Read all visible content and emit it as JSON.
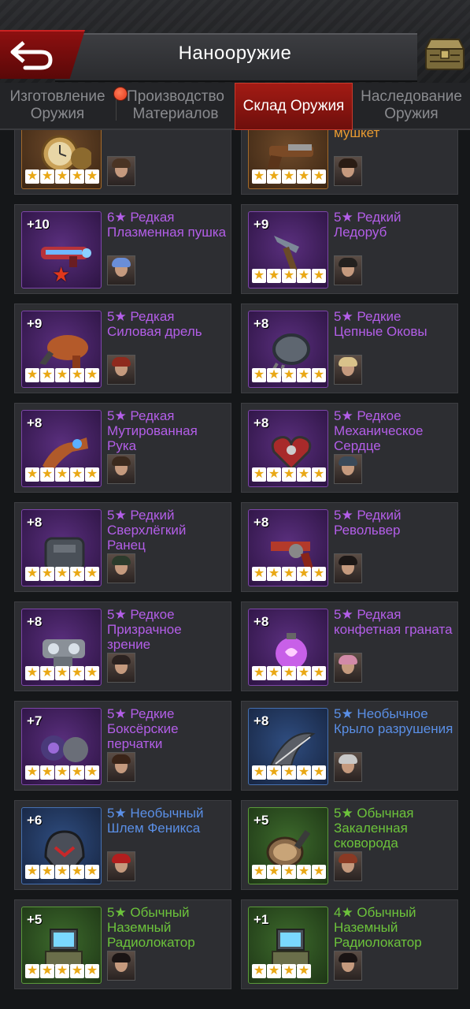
{
  "header": {
    "title": "Нанооружие",
    "back_icon": "back-arrow-icon",
    "chest_icon": "weapon-chest-icon"
  },
  "tabs": [
    {
      "label": "Изготовление Оружия",
      "has_notification": true
    },
    {
      "label": "Производство Материалов",
      "has_notification": false
    },
    {
      "label": "Склад Оружия",
      "active": true
    },
    {
      "label": "Наследование Оружия",
      "has_notification": false
    }
  ],
  "colors": {
    "rare": "#b35ee8",
    "legendary": "#e79a31",
    "uncommon": "#5a8fe6",
    "common": "#6cc33b",
    "active_tab": "#a31b14"
  },
  "weapons": [
    {
      "name": "Карманные часы",
      "level": "",
      "stars": 5,
      "rarity": "orange",
      "avatar_hair": "#4a3424",
      "icon": "pocket-watch-icon"
    },
    {
      "name": "Кремневый мушкет",
      "level": "",
      "stars": 5,
      "rarity": "orange",
      "avatar_hair": "#2a1c14",
      "icon": "flintlock-musket-icon"
    },
    {
      "name": "6★ Редкая Плазменная пушка",
      "level": "+10",
      "stars": 0,
      "rarity": "purple",
      "avatar_hair": "#6a8ed8",
      "icon": "plasma-cannon-icon",
      "big_star": "★"
    },
    {
      "name": "5★ Редкий Ледоруб",
      "level": "+9",
      "stars": 5,
      "rarity": "purple",
      "avatar_hair": "#23201e",
      "icon": "ice-axe-icon"
    },
    {
      "name": "5★ Редкая Силовая дрель",
      "level": "+9",
      "stars": 5,
      "rarity": "purple",
      "avatar_hair": "#8e2a1e",
      "icon": "power-drill-icon"
    },
    {
      "name": "5★ Редкие Цепные Оковы",
      "level": "+8",
      "stars": 5,
      "rarity": "purple",
      "avatar_hair": "#d9c28a",
      "icon": "chain-shackles-icon"
    },
    {
      "name": "5★ Редкая Мутированная Рука",
      "level": "+8",
      "stars": 5,
      "rarity": "purple",
      "avatar_hair": "#3b2a1e",
      "icon": "mutated-arm-icon"
    },
    {
      "name": "5★ Редкое Механическое Сердце",
      "level": "+8",
      "stars": 5,
      "rarity": "purple",
      "avatar_hair": "#3a4a5a",
      "icon": "mechanical-heart-icon"
    },
    {
      "name": "5★ Редкий Сверхлёгкий Ранец",
      "level": "+8",
      "stars": 5,
      "rarity": "purple",
      "avatar_hair": "#2c3b2c",
      "icon": "ultralight-pack-icon"
    },
    {
      "name": "5★ Редкий Револьвер",
      "level": "+8",
      "stars": 5,
      "rarity": "purple",
      "avatar_hair": "#1c1716",
      "icon": "revolver-icon"
    },
    {
      "name": "5★ Редкое Призрачное зрение",
      "level": "+8",
      "stars": 5,
      "rarity": "purple",
      "avatar_hair": "#2b2220",
      "icon": "ghost-vision-icon"
    },
    {
      "name": "5★ Редкая конфетная граната",
      "level": "+8",
      "stars": 5,
      "rarity": "purple",
      "avatar_hair": "#d28aa8",
      "icon": "candy-grenade-icon"
    },
    {
      "name": "5★ Редкие Боксёрские перчатки",
      "level": "+7",
      "stars": 5,
      "rarity": "purple",
      "avatar_hair": "#3a2418",
      "icon": "boxing-gloves-icon"
    },
    {
      "name": "5★ Необычное Крыло разрушения",
      "level": "+8",
      "stars": 5,
      "rarity": "blue",
      "avatar_hair": "#c8c8c8",
      "icon": "wing-of-destruction-icon"
    },
    {
      "name": "5★ Необычный Шлем Феникса",
      "level": "+6",
      "stars": 5,
      "rarity": "blue",
      "avatar_hair": "#b21e1e",
      "icon": "phoenix-helmet-icon"
    },
    {
      "name": "5★ Обычная Закаленная сковорода",
      "level": "+5",
      "stars": 5,
      "rarity": "green",
      "avatar_hair": "#8a3a24",
      "icon": "frying-pan-icon"
    },
    {
      "name": "5★ Обычный Наземный Радиолокатор",
      "level": "+5",
      "stars": 5,
      "rarity": "green",
      "avatar_hair": "#1a1414",
      "icon": "ground-radar-icon"
    },
    {
      "name": "4★ Обычный Наземный Радиолокатор",
      "level": "+1",
      "stars": 4,
      "rarity": "green",
      "avatar_hair": "#1a1414",
      "icon": "ground-radar-icon"
    }
  ]
}
